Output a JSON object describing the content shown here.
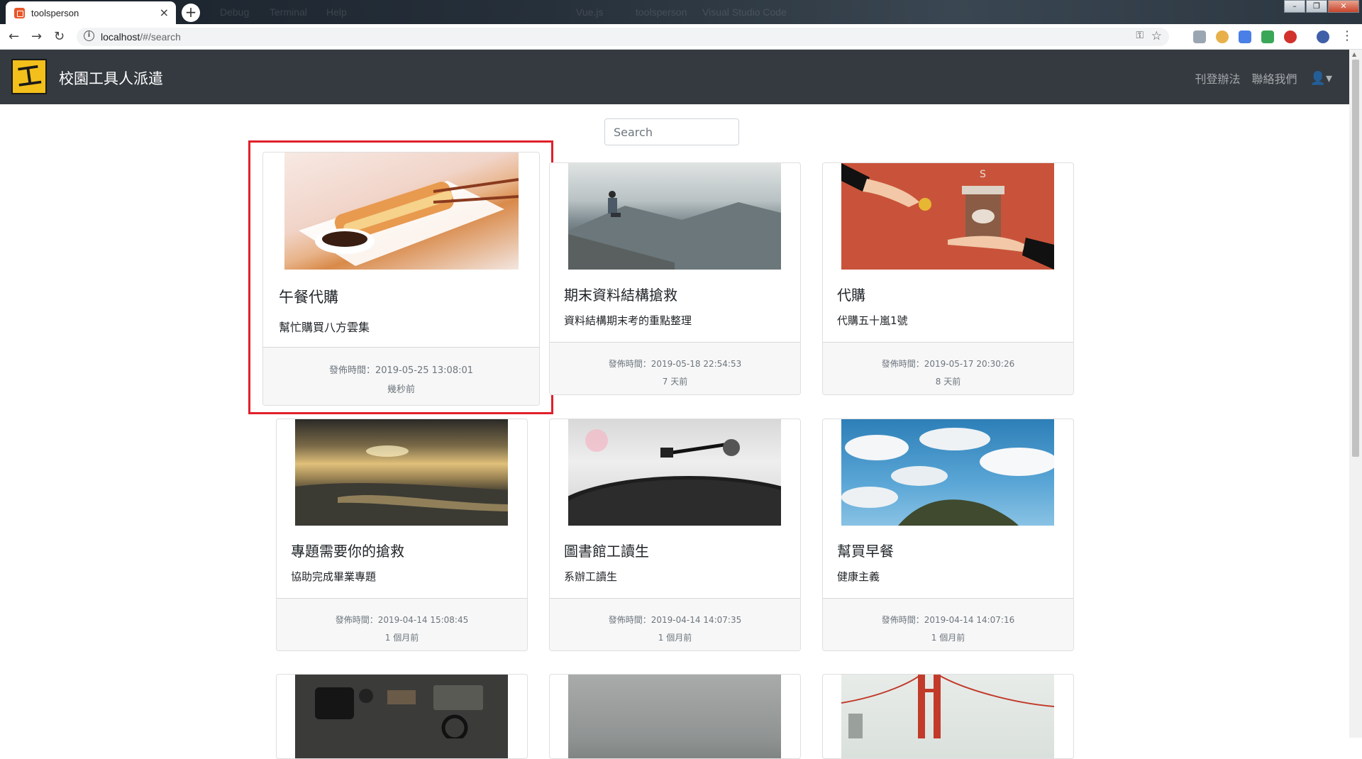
{
  "browser": {
    "tab_title": "toolsperson",
    "tab_close": "×",
    "new_tab": "+",
    "url_host": "localhost",
    "url_path": "/#/search",
    "info_glyph": "i",
    "background_titles": [
      "Debug",
      "Terminal",
      "Help",
      "Vue.js",
      "toolsperson",
      "Visual Studio Code"
    ]
  },
  "app": {
    "logo_char": "工",
    "brand": "校園工具人派遣",
    "nav": {
      "post_rules": "刊登辦法",
      "contact": "聯絡我們"
    },
    "search_placeholder": "Search"
  },
  "cards": [
    {
      "title": "午餐代購",
      "text": "幫忙購買八方雲集",
      "posted": "發佈時間：2019-05-25 13:08:01",
      "ago": "幾秒前",
      "image": "dumplings-photo"
    },
    {
      "title": "期末資料結構搶救",
      "text": "資料結構期末考的重點整理",
      "posted": "發佈時間：2019-05-18 22:54:53",
      "ago": "7 天前",
      "image": "mountain-view-photo"
    },
    {
      "title": "代購",
      "text": "代購五十嵐1號",
      "posted": "發佈時間：2019-05-17 20:30:26",
      "ago": "8 天前",
      "image": "coffee-payment-illustration"
    },
    {
      "title": "專題需要你的搶救",
      "text": "協助完成畢業專題",
      "posted": "發佈時間：2019-04-14 15:08:45",
      "ago": "1 個月前",
      "image": "beach-sunset-photo"
    },
    {
      "title": "圖書館工讀生",
      "text": "系辦工讀生",
      "posted": "發佈時間：2019-04-14 14:07:35",
      "ago": "1 個月前",
      "image": "record-player-photo"
    },
    {
      "title": "幫買早餐",
      "text": "健康主義",
      "posted": "發佈時間：2019-04-14 14:07:16",
      "ago": "1 個月前",
      "image": "cloudy-sky-photo"
    }
  ],
  "colors": {
    "navbar": "#343a40",
    "highlight": "#e0202a",
    "logo": "#f3c01b"
  }
}
